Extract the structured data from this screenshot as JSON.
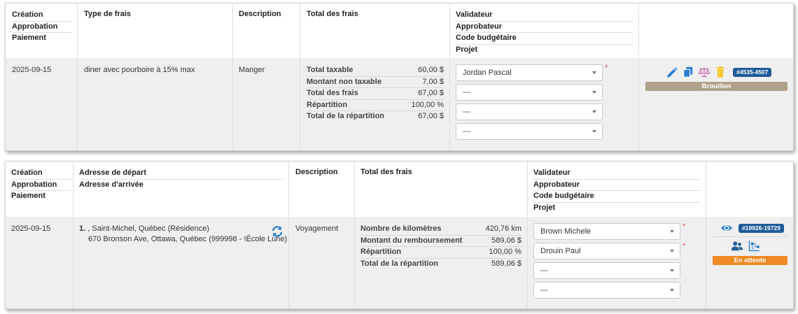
{
  "colors": {
    "draft_status": "#b0a18c",
    "pending_status": "#f08a24",
    "id_badge": "#1f5b99",
    "icon_blue": "#2a7fd4",
    "icon_pink": "#c76aa5",
    "icon_yellow": "#f1c40f",
    "required": "#d9534f"
  },
  "card1": {
    "headers": {
      "dates": [
        "Création",
        "Approbation",
        "Paiement"
      ],
      "type": "Type de frais",
      "description": "Description",
      "totals": "Total des frais",
      "approvals": [
        "Validateur",
        "Approbateur",
        "Code budgétaire",
        "Projet"
      ]
    },
    "row": {
      "date": "2025-09-15",
      "type": "diner avec pourboire à 15% max",
      "description": "Manger",
      "totals": [
        {
          "label": "Total taxable",
          "value": "60,00 $"
        },
        {
          "label": "Montant non taxable",
          "value": "7,00 $"
        },
        {
          "label": "Total des frais",
          "value": "67,00 $"
        },
        {
          "label": "Répartition",
          "value": "100,00 %"
        },
        {
          "label": "Total de la répartition",
          "value": "67,00 $"
        }
      ],
      "selects": [
        "Jordan Pascal",
        "---",
        "---",
        "---"
      ],
      "required_mark": "*",
      "actions": [
        "pencil-icon",
        "copy-icon",
        "balance-scale-icon",
        "trash-icon"
      ],
      "id_badge": "#4535-4507",
      "status": "Brouillon"
    }
  },
  "card2": {
    "headers": {
      "dates": [
        "Création",
        "Approbation",
        "Paiement"
      ],
      "address": [
        "Adresse de départ",
        "Adresse d'arrivée"
      ],
      "description": "Description",
      "totals": "Total des frais",
      "approvals": [
        "Validateur",
        "Approbateur",
        "Code budgétaire",
        "Projet"
      ]
    },
    "row": {
      "date": "2025-09-15",
      "address_num": "1.",
      "address_line1": ", Saint-Michel, Québec (Résidence)",
      "address_line2": "670 Bronson Ave, Ottawa, Québec (999998 - !École Lune)",
      "description": "Voyagement",
      "totals": [
        {
          "label": "Nombre de kilomètres",
          "value": "420,76 km"
        },
        {
          "label": "Montant du remboursement",
          "value": "589,06 $"
        },
        {
          "label": "Répartition",
          "value": "100,00 %"
        },
        {
          "label": "Total de la répartition",
          "value": "589,06 $"
        }
      ],
      "selects": [
        "Brown Michele",
        "Drouin Paul",
        "---",
        "---"
      ],
      "required_mark": "*",
      "actions": [
        "eye-icon",
        "users-icon",
        "org-chart-icon",
        "refresh-icon"
      ],
      "id_badge": "#19926-19729",
      "status": "En attente"
    }
  }
}
